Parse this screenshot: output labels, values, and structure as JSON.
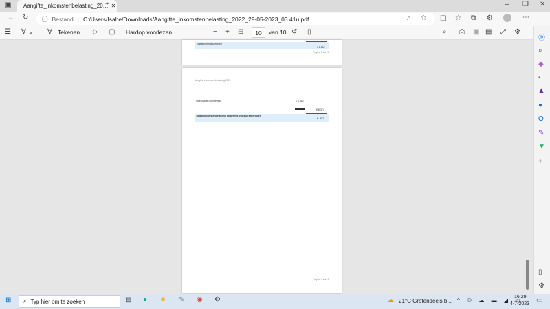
{
  "tab": {
    "title": "Aangifte_inkomstenbelasting_20…"
  },
  "address": {
    "label": "Bestand",
    "url": "C:/Users/Isabe/Downloads/Aangifte_inkomstenbelasting_2022_29-05-2023_03.41u.pdf"
  },
  "pdf_toolbar": {
    "draw": "Tekenen",
    "read_aloud": "Hardop voorlezen",
    "page": "10",
    "of": "van 10"
  },
  "page1": {
    "row_label": "Totaal heffingskortingen",
    "row_value": "€ 2.862",
    "footer": "Pagina 8 van 9"
  },
  "page2": {
    "header": "Aangifte inkomstenbelasting 2022",
    "row1_label": "Ingehouden loonheffing",
    "row1_value": "€ 5.512",
    "subtotal": "€ 8.374",
    "total_label": "Totaal inkomstenbelasting en premie volksverzekeringen",
    "total_value": "€ -307",
    "footer": "Pagina 9 van 9"
  },
  "taskbar": {
    "search_placeholder": "Typ hier om te zoeken",
    "weather": "21°C  Grotendeels b...",
    "time": "16:29",
    "date": "4-7-2023"
  }
}
